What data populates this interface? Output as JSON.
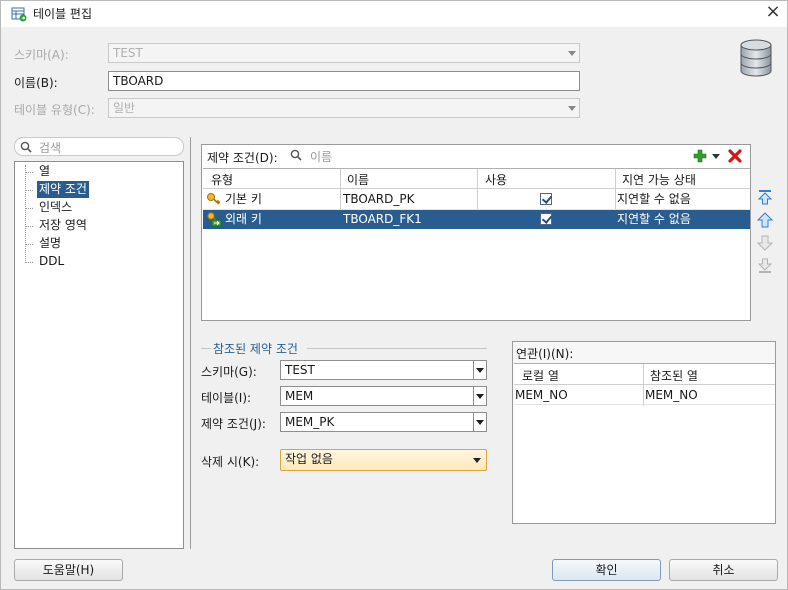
{
  "window": {
    "title": "테이블 편집",
    "close_glyph": "×"
  },
  "form": {
    "schema_label": "스키마(A):",
    "schema_value": "TEST",
    "name_label": "이름(B):",
    "name_value": "TBOARD",
    "table_type_label": "테이블 유형(C):",
    "table_type_value": "일반"
  },
  "search": {
    "placeholder": "검색"
  },
  "tree": {
    "items": [
      {
        "label": "열"
      },
      {
        "label": "제약 조건"
      },
      {
        "label": "인덱스"
      },
      {
        "label": "저장 영역"
      },
      {
        "label": "설명"
      },
      {
        "label": "DDL"
      }
    ],
    "selected_index": 1
  },
  "constraints": {
    "label": "제약 조건(D):",
    "filter_placeholder": "이름",
    "columns": [
      "유형",
      "이름",
      "사용",
      "지연 가능 상태"
    ],
    "rows": [
      {
        "type": "기본 키",
        "name": "TBOARD_PK",
        "enabled": true,
        "deferrable": "지연할 수 없음"
      },
      {
        "type": "외래 키",
        "name": "TBOARD_FK1",
        "enabled": true,
        "deferrable": "지연할 수 없음"
      }
    ],
    "selected_row": 1
  },
  "referenced": {
    "section_title": "참조된 제약 조건",
    "schema_label": "스키마(G):",
    "schema_value": "TEST",
    "table_label": "테이블(I):",
    "table_value": "MEM",
    "constraint_label": "제약 조건(J):",
    "constraint_value": "MEM_PK",
    "on_delete_label": "삭제 시(K):",
    "on_delete_value": "작업 없음"
  },
  "association": {
    "label": "연관(I)(N):",
    "columns": [
      "로컬 열",
      "참조된 열"
    ],
    "rows": [
      {
        "local": "MEM_NO",
        "referenced": "MEM_NO"
      }
    ]
  },
  "buttons": {
    "help": "도움말(H)",
    "ok": "확인",
    "cancel": "취소"
  },
  "colors": {
    "selection": "#2a5d8f",
    "add_green": "#2e9e2e",
    "delete_red": "#d01818",
    "arrow_blue": "#2f7fd6"
  }
}
